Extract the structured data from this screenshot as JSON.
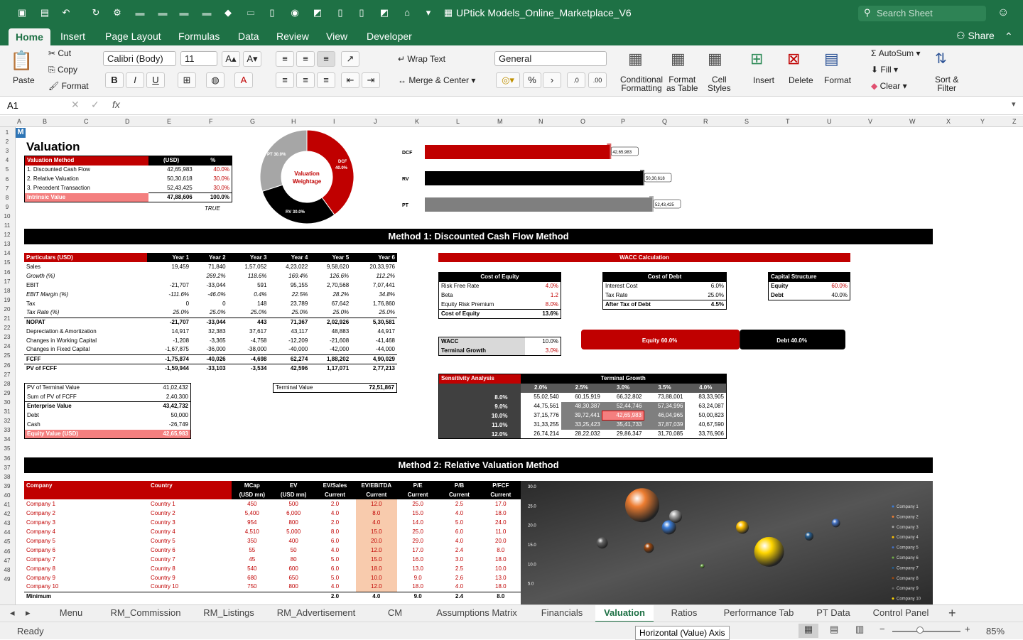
{
  "app": {
    "doc_title": "UPtick Models_Online_Marketplace_V6",
    "search_placeholder": "Search Sheet",
    "share": "Share"
  },
  "ribbon_tabs": [
    "Home",
    "Insert",
    "Page Layout",
    "Formulas",
    "Data",
    "Review",
    "View",
    "Developer"
  ],
  "ribbon": {
    "paste": "Paste",
    "cut": "Cut",
    "copy": "Copy",
    "format": "Format",
    "font": "Calibri (Body)",
    "size": "11",
    "wrap": "Wrap Text",
    "merge": "Merge & Center",
    "number_format": "General",
    "cond1": "Conditional",
    "cond2": "Formatting",
    "fat1": "Format",
    "fat2": "as Table",
    "cs1": "Cell",
    "cs2": "Styles",
    "insert": "Insert",
    "delete": "Delete",
    "format2": "Format",
    "autosum": "AutoSum",
    "fill": "Fill",
    "clear": "Clear",
    "sort1": "Sort &",
    "sort2": "Filter",
    "bold": "B",
    "italic": "I",
    "underline": "U",
    "pct": "%"
  },
  "formula_bar": {
    "cell_ref": "A1",
    "fx": "fx",
    "x": "✕",
    "check": "✓"
  },
  "columns": [
    "A",
    "B",
    "C",
    "D",
    "E",
    "F",
    "G",
    "H",
    "I",
    "J",
    "K",
    "L",
    "M",
    "N",
    "O",
    "P",
    "Q",
    "R",
    "S",
    "T",
    "U",
    "V",
    "W",
    "X",
    "Y",
    "Z"
  ],
  "rows": [
    "1",
    "2",
    "3",
    "4",
    "5",
    "6",
    "7",
    "8",
    "9",
    "10",
    "11",
    "12",
    "13",
    "14",
    "15",
    "16",
    "17",
    "18",
    "19",
    "20",
    "21",
    "22",
    "23",
    "24",
    "25",
    "26",
    "27",
    "28",
    "29",
    "30",
    "31",
    "32",
    "33",
    "34",
    "35",
    "36",
    "37",
    "38",
    "39",
    "40",
    "41",
    "42",
    "43",
    "44",
    "45",
    "46",
    "47",
    "48",
    "49"
  ],
  "logo": "M",
  "valuation": {
    "title": "Valuation",
    "h": [
      "Valuation Method",
      "(USD)",
      "%"
    ],
    "rows": [
      [
        "1. Discounted Cash Flow",
        "42,65,983",
        "40.0%"
      ],
      [
        "2. Relative Valuation",
        "50,30,618",
        "30.0%"
      ],
      [
        "3. Precedent Transaction",
        "52,43,425",
        "30.0%"
      ]
    ],
    "total": [
      "Intrinsic Value",
      "47,88,606",
      "100.0%"
    ],
    "flag": "TRUE"
  },
  "donut": {
    "center1": "Valuation",
    "center2": "Weightage",
    "l_pt": "PT 30.0%",
    "l_dcf": "DCF",
    "l_dcf2": "40.0%",
    "l_rv": "RV 30.0%"
  },
  "chart_data": [
    {
      "type": "pie",
      "title": "Valuation Weightage",
      "categories": [
        "DCF",
        "RV",
        "PT"
      ],
      "values": [
        40,
        30,
        30
      ],
      "colors": [
        "#c00000",
        "#000000",
        "#a6a6a6"
      ]
    },
    {
      "type": "bar",
      "categories": [
        "DCF",
        "RV",
        "PT"
      ],
      "values": [
        4265983,
        5030618,
        5243425
      ],
      "labels": [
        "42,65,983",
        "50,30,618",
        "52,43,425"
      ],
      "colors": [
        "#c00000",
        "#000000",
        "#7f7f7f"
      ]
    },
    {
      "type": "bar",
      "stacked": true,
      "categories": [
        "Capital Structure"
      ],
      "series": [
        {
          "name": "Equity",
          "values": [
            60
          ]
        },
        {
          "name": "Debt",
          "values": [
            40
          ]
        }
      ],
      "labels": [
        "Equity 60.0%",
        "Debt 40.0%"
      ]
    },
    {
      "type": "scatter",
      "ylim": [
        0,
        30
      ],
      "yticks": [
        "30.0",
        "25.0",
        "20.0",
        "15.0",
        "10.0",
        "5.0"
      ],
      "series": [
        {
          "name": "Company 1",
          "color": "#3b7dd8",
          "x": 1.9,
          "y": 19.5
        },
        {
          "name": "Company 2",
          "color": "#ed7d31",
          "x": 1.5,
          "y": 25.2
        },
        {
          "name": "Company 3",
          "color": "#a5a5a5",
          "x": 2.0,
          "y": 22.3
        },
        {
          "name": "Company 4",
          "color": "#ffc000",
          "x": 3.0,
          "y": 19.5
        },
        {
          "name": "Company 5",
          "color": "#4472c4",
          "x": 4.4,
          "y": 20.6
        },
        {
          "name": "Company 6",
          "color": "#70ad47",
          "x": 2.4,
          "y": 9.5
        },
        {
          "name": "Company 7",
          "color": "#255e91",
          "x": 4.0,
          "y": 17.2
        },
        {
          "name": "Company 8",
          "color": "#9e480e",
          "x": 1.6,
          "y": 14.2
        },
        {
          "name": "Company 9",
          "color": "#636363",
          "x": 0.9,
          "y": 15.5
        },
        {
          "name": "Company 10",
          "color": "#ffd600",
          "x": 3.4,
          "y": 13.2
        }
      ],
      "legend": "right"
    }
  ],
  "method1": "Method 1: Discounted Cash Flow Method",
  "dcf": {
    "header": [
      "Particulars (USD)",
      "Year 1",
      "Year 2",
      "Year 3",
      "Year 4",
      "Year 5",
      "Year 6"
    ],
    "rows": [
      {
        "cells": [
          "Sales",
          "19,459",
          "71,840",
          "1,57,052",
          "4,23,022",
          "9,58,620",
          "20,33,976"
        ]
      },
      {
        "cells": [
          "Growth (%)",
          "",
          "269.2%",
          "118.6%",
          "169.4%",
          "126.6%",
          "112.2%"
        ],
        "it": true
      },
      {
        "cells": [
          "EBIT",
          "-21,707",
          "-33,044",
          "591",
          "95,155",
          "2,70,568",
          "7,07,441"
        ]
      },
      {
        "cells": [
          "EBIT Margin (%)",
          "-111.6%",
          "-46.0%",
          "0.4%",
          "22.5%",
          "28.2%",
          "34.8%"
        ],
        "it": true
      },
      {
        "cells": [
          "Tax",
          "0",
          "0",
          "148",
          "23,789",
          "67,642",
          "1,76,860"
        ]
      },
      {
        "cells": [
          "Tax Rate (%)",
          "25.0%",
          "25.0%",
          "25.0%",
          "25.0%",
          "25.0%",
          "25.0%"
        ],
        "it": true
      },
      {
        "cells": [
          "NOPAT",
          "-21,707",
          "-33,044",
          "443",
          "71,367",
          "2,02,926",
          "5,30,581"
        ],
        "bold": true,
        "top": true
      },
      {
        "cells": [
          "Depreciation & Amortization",
          "14,917",
          "32,383",
          "37,617",
          "43,117",
          "48,883",
          "44,917"
        ]
      },
      {
        "cells": [
          "Changes in Working Capital",
          "-1,208",
          "-3,365",
          "-4,758",
          "-12,209",
          "-21,608",
          "-41,468"
        ]
      },
      {
        "cells": [
          "Changes in Fixed Capital",
          "-1,67,875",
          "-36,000",
          "-38,000",
          "-40,000",
          "-42,000",
          "-44,000"
        ]
      },
      {
        "cells": [
          "FCFF",
          "-1,75,874",
          "-40,026",
          "-4,698",
          "62,274",
          "1,88,202",
          "4,90,029"
        ],
        "bold": true,
        "top": true
      },
      {
        "cells": [
          "PV of FCFF",
          "-1,59,944",
          "-33,103",
          "-3,534",
          "42,596",
          "1,17,071",
          "2,77,213"
        ],
        "bold": true,
        "top": true
      }
    ]
  },
  "ev": {
    "rows": [
      [
        "PV of Terminal Value",
        "41,02,432"
      ],
      [
        "Sum of PV of FCFF",
        "2,40,300"
      ],
      [
        "Enterprise Value",
        "43,42,732"
      ],
      [
        "Debt",
        "50,000"
      ],
      [
        "Cash",
        "-26,749"
      ]
    ],
    "total": [
      "Equity Value (USD)",
      "42,65,983"
    ]
  },
  "tv": {
    "label": "Terminal Value",
    "value": "72,51,867"
  },
  "wacc": {
    "title": "WACC Calculation",
    "coe": {
      "h": "Cost of Equity",
      "rows": [
        [
          "Risk Free Rate",
          "4.0%"
        ],
        [
          "Beta",
          "1.2"
        ],
        [
          "Equity Risk Premium",
          "8.0%"
        ]
      ],
      "total": [
        "Cost of Equity",
        "13.6%"
      ]
    },
    "cod": {
      "h": "Cost of Debt",
      "rows": [
        [
          "Interest Cost",
          "6.0%"
        ],
        [
          "Tax Rate",
          "25.0%"
        ]
      ],
      "total": [
        "After Tax of Debt",
        "4.5%"
      ]
    },
    "cap": {
      "h": "Capital Structure",
      "rows": [
        [
          "Equity",
          "60.0%"
        ],
        [
          "Debt",
          "40.0%"
        ]
      ]
    },
    "w": [
      [
        "WACC",
        "10.0%"
      ],
      [
        "Terminal Growth",
        "3.0%"
      ]
    ]
  },
  "sens": {
    "title": "Sensitivity Analysis",
    "tg": "Terminal Growth",
    "wacc": "WACC",
    "cols": [
      "2.0%",
      "2.5%",
      "3.0%",
      "3.5%",
      "4.0%"
    ],
    "rows": [
      {
        "w": "8.0%",
        "v": [
          "55,02,540",
          "60,15,919",
          "66,32,802",
          "73,88,001",
          "83,33,905"
        ]
      },
      {
        "w": "9.0%",
        "v": [
          "44,75,561",
          "48,30,387",
          "52,44,746",
          "57,34,996",
          "63,24,087"
        ]
      },
      {
        "w": "10.0%",
        "v": [
          "37,15,776",
          "39,72,441",
          "42,65,983",
          "46,04,965",
          "50,00,823"
        ]
      },
      {
        "w": "11.0%",
        "v": [
          "31,33,255",
          "33,25,423",
          "35,41,733",
          "37,87,039",
          "40,67,590"
        ]
      },
      {
        "w": "12.0%",
        "v": [
          "26,74,214",
          "28,22,032",
          "29,86,347",
          "31,70,085",
          "33,76,906"
        ]
      }
    ]
  },
  "method2": "Method 2: Relative Valuation Method",
  "rel": {
    "h1": [
      "Company",
      "Country",
      "MCap",
      "EV",
      "EV/Sales",
      "EV/EBITDA",
      "P/E",
      "P/B",
      "P/FCF"
    ],
    "h2": [
      "",
      "",
      "(USD mn)",
      "(USD mn)",
      "Current",
      "Current",
      "Current",
      "Current",
      "Current"
    ],
    "rows": [
      [
        "Company 1",
        "Country 1",
        "450",
        "500",
        "2.0",
        "12.0",
        "25.0",
        "2.5",
        "17.0"
      ],
      [
        "Company 2",
        "Country 2",
        "5,400",
        "6,000",
        "4.0",
        "8.0",
        "15.0",
        "4.0",
        "18.0"
      ],
      [
        "Company 3",
        "Country 3",
        "954",
        "800",
        "2.0",
        "4.0",
        "14.0",
        "5.0",
        "24.0"
      ],
      [
        "Company 4",
        "Country 4",
        "4,510",
        "5,000",
        "8.0",
        "15.0",
        "25.0",
        "6.0",
        "11.0"
      ],
      [
        "Company 5",
        "Country 5",
        "350",
        "400",
        "6.0",
        "20.0",
        "29.0",
        "4.0",
        "20.0"
      ],
      [
        "Company 6",
        "Country 6",
        "55",
        "50",
        "4.0",
        "12.0",
        "17.0",
        "2.4",
        "8.0"
      ],
      [
        "Company 7",
        "Country 7",
        "45",
        "80",
        "5.0",
        "15.0",
        "16.0",
        "3.0",
        "18.0"
      ],
      [
        "Company 8",
        "Country 8",
        "540",
        "600",
        "6.0",
        "18.0",
        "13.0",
        "2.5",
        "10.0"
      ],
      [
        "Company 9",
        "Country 9",
        "680",
        "650",
        "5.0",
        "10.0",
        "9.0",
        "2.6",
        "13.0"
      ],
      [
        "Company 10",
        "Country 10",
        "750",
        "800",
        "4.0",
        "12.0",
        "18.0",
        "4.0",
        "18.0"
      ]
    ],
    "min": [
      "Minimum",
      "",
      "",
      "",
      "2.0",
      "4.0",
      "9.0",
      "2.4",
      "8.0"
    ]
  },
  "sheet_tabs": [
    "Menu",
    "RM_Commission",
    "RM_Listings",
    "RM_Advertisement",
    "CM",
    "Assumptions Matrix",
    "Financials",
    "Valuation",
    "Ratios",
    "Performance Tab",
    "PT Data",
    "Control Panel"
  ],
  "status": {
    "ready": "Ready",
    "tooltip": "Horizontal (Value) Axis",
    "zoom": "85%"
  }
}
